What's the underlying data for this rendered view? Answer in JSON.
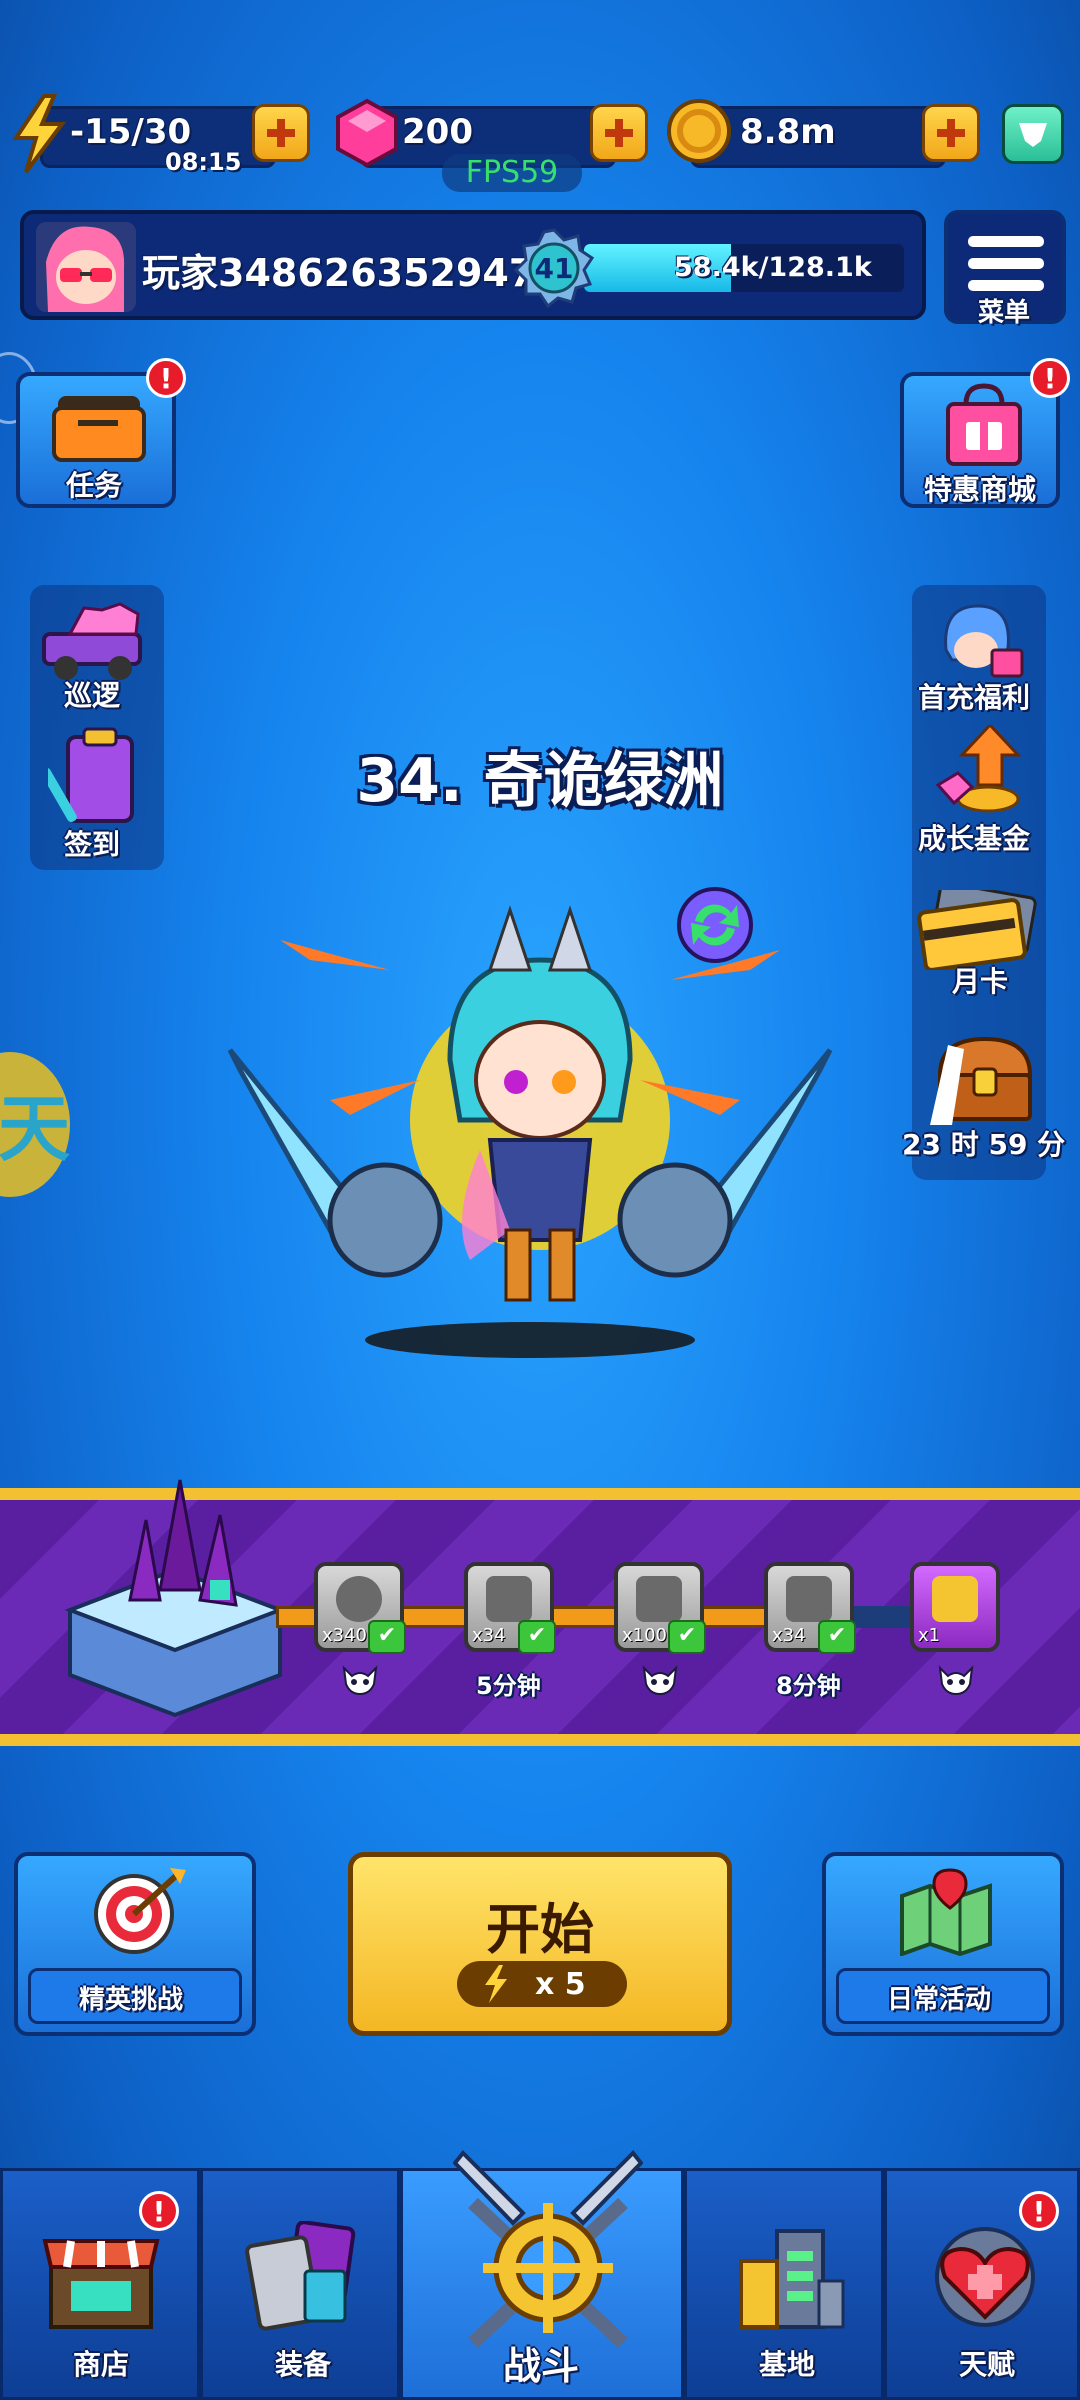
{
  "top_bar": {
    "energy": "-15/30",
    "energy_timer": "08:15",
    "gems": "200",
    "coins": "8.8m",
    "fps": "FPS59"
  },
  "player": {
    "name": "玩家3486263529475",
    "level": "41",
    "exp_text": "58.4k/128.1k",
    "exp_progress": 0.46,
    "menu_label": "菜单"
  },
  "left_buttons": {
    "task": "任务",
    "patrol": "巡逻",
    "signin": "签到"
  },
  "right_buttons": {
    "shop_special": "特惠商城",
    "first_recharge": "首充福利",
    "growth_fund": "成长基金",
    "monthly_card": "月卡",
    "timer": "23 时 59 分"
  },
  "stage": {
    "title": "34. 奇诡绿洲"
  },
  "rewards": [
    {
      "count": "x3400",
      "sub": "",
      "checked": true
    },
    {
      "count": "x34",
      "sub": "5分钟",
      "checked": true
    },
    {
      "count": "x100",
      "sub": "",
      "checked": true
    },
    {
      "count": "x34",
      "sub": "8分钟",
      "checked": true
    },
    {
      "count": "x1",
      "sub": "",
      "checked": false
    }
  ],
  "actions": {
    "elite": "精英挑战",
    "start": "开始",
    "start_cost": "x 5",
    "daily": "日常活动"
  },
  "nav": {
    "shop": "商店",
    "equip": "装备",
    "battle": "战斗",
    "base": "基地",
    "talent": "天赋"
  },
  "colors": {
    "accent_yellow": "#ffd54a",
    "purple_band": "#5a1fa0",
    "badge_red": "#e81b2b"
  }
}
